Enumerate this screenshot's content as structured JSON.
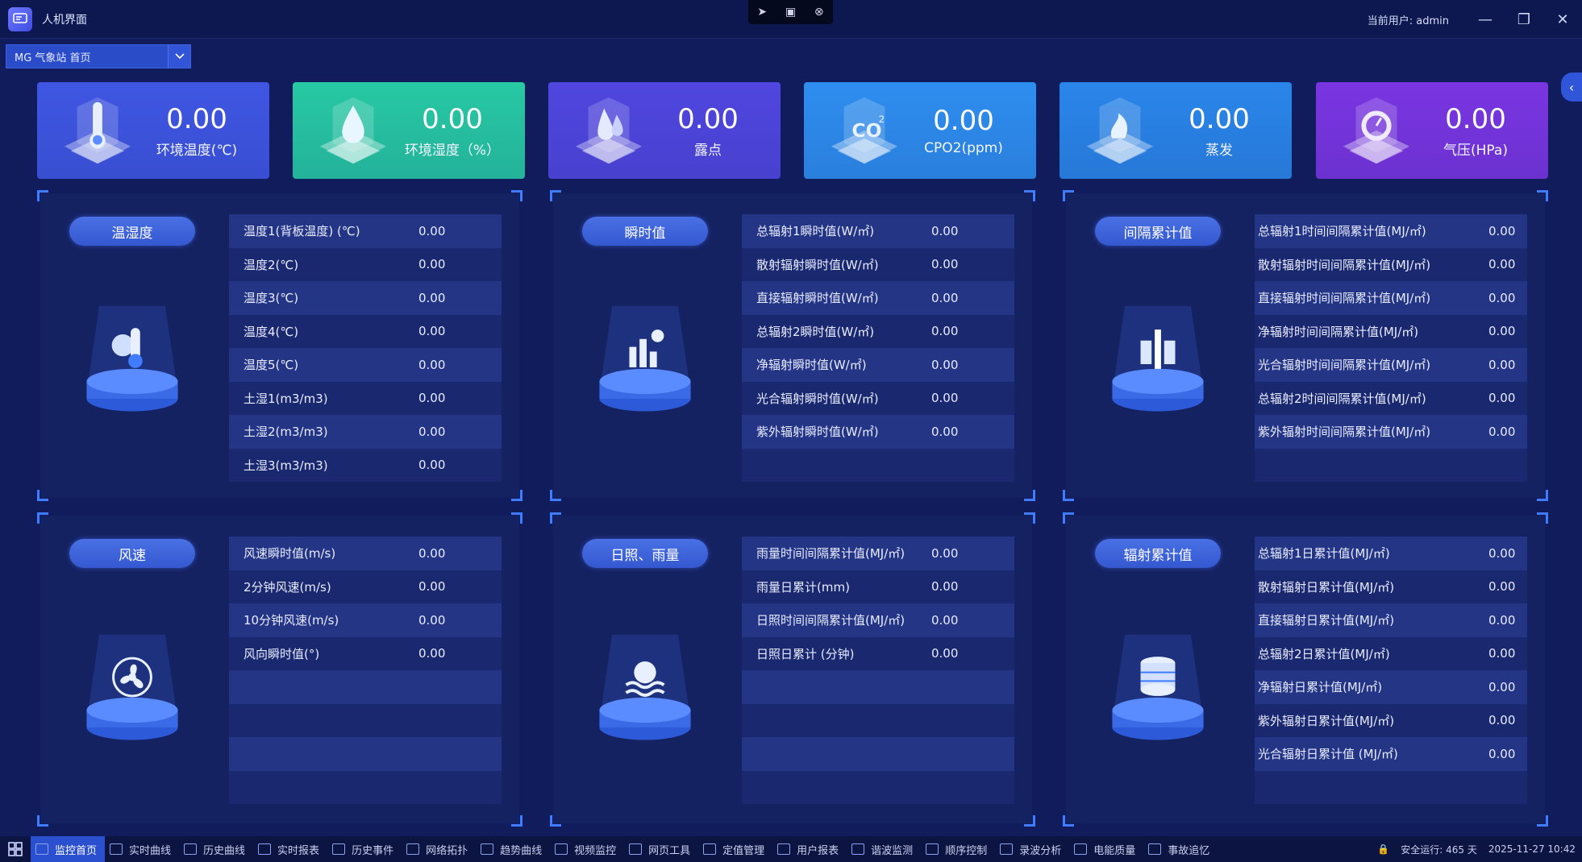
{
  "window": {
    "title": "人机界面",
    "user": "当前用户: admin"
  },
  "page_select": {
    "value": "MG 气象站 首页"
  },
  "cards": [
    {
      "value": "0.00",
      "label": "环境温度(℃)",
      "color": "#3f56e3",
      "icon": "thermometer-icon"
    },
    {
      "value": "0.00",
      "label": "环境湿度（%）",
      "color": "#27c9a4",
      "icon": "humidity-drop-icon"
    },
    {
      "value": "0.00",
      "label": "露点",
      "color": "#5046e0",
      "icon": "dew-point-icon"
    },
    {
      "value": "0.00",
      "label": "CPO2(ppm)",
      "color": "#2e8ef0",
      "icon": "co2-icon"
    },
    {
      "value": "0.00",
      "label": "蒸发",
      "color": "#2a86ea",
      "icon": "evaporation-icon"
    },
    {
      "value": "0.00",
      "label": "气压(HPa)",
      "color": "#7a35e2",
      "icon": "pressure-gauge-icon"
    }
  ],
  "panels": {
    "temp_humidity": {
      "title": "温湿度",
      "rows": [
        {
          "k": "温度1(背板温度) (℃)",
          "v": "0.00"
        },
        {
          "k": "温度2(℃)",
          "v": "0.00"
        },
        {
          "k": "温度3(℃)",
          "v": "0.00"
        },
        {
          "k": "温度4(℃)",
          "v": "0.00"
        },
        {
          "k": "温度5(℃)",
          "v": "0.00"
        },
        {
          "k": "土湿1(m3/m3)",
          "v": "0.00"
        },
        {
          "k": "土湿2(m3/m3)",
          "v": "0.00"
        },
        {
          "k": "土湿3(m3/m3)",
          "v": "0.00"
        }
      ]
    },
    "instant": {
      "title": "瞬时值",
      "rows": [
        {
          "k": "总辐射1瞬时值(W/㎡)",
          "v": "0.00"
        },
        {
          "k": "散射辐射瞬时值(W/㎡)",
          "v": "0.00"
        },
        {
          "k": "直接辐射瞬时值(W/㎡)",
          "v": "0.00"
        },
        {
          "k": "总辐射2瞬时值(W/㎡)",
          "v": "0.00"
        },
        {
          "k": "净辐射瞬时值(W/㎡)",
          "v": "0.00"
        },
        {
          "k": "光合辐射瞬时值(W/㎡)",
          "v": "0.00"
        },
        {
          "k": "紫外辐射瞬时值(W/㎡)",
          "v": "0.00"
        },
        {
          "k": "",
          "v": ""
        }
      ]
    },
    "interval": {
      "title": "间隔累计值",
      "rows": [
        {
          "k": "总辐射1时间间隔累计值(MJ/㎡)",
          "v": "0.00"
        },
        {
          "k": "散射辐射时间间隔累计值(MJ/㎡)",
          "v": "0.00"
        },
        {
          "k": "直接辐射时间间隔累计值(MJ/㎡)",
          "v": "0.00"
        },
        {
          "k": "净辐射时间间隔累计值(MJ/㎡)",
          "v": "0.00"
        },
        {
          "k": "光合辐射时间间隔累计值(MJ/㎡)",
          "v": "0.00"
        },
        {
          "k": "总辐射2时间间隔累计值(MJ/㎡)",
          "v": "0.00"
        },
        {
          "k": "紫外辐射时间间隔累计值(MJ/㎡)",
          "v": "0.00"
        },
        {
          "k": "",
          "v": ""
        }
      ]
    },
    "wind": {
      "title": "风速",
      "rows": [
        {
          "k": "风速瞬时值(m/s)",
          "v": "0.00"
        },
        {
          "k": "2分钟风速(m/s)",
          "v": "0.00"
        },
        {
          "k": "10分钟风速(m/s)",
          "v": "0.00"
        },
        {
          "k": "风向瞬时值(°)",
          "v": "0.00"
        },
        {
          "k": "",
          "v": ""
        },
        {
          "k": "",
          "v": ""
        },
        {
          "k": "",
          "v": ""
        },
        {
          "k": "",
          "v": ""
        }
      ]
    },
    "sun_rain": {
      "title": "日照、雨量",
      "rows": [
        {
          "k": "雨量时间间隔累计值(MJ/㎡)",
          "v": "0.00"
        },
        {
          "k": "雨量日累计(mm)",
          "v": "0.00"
        },
        {
          "k": "日照时间间隔累计值(MJ/㎡)",
          "v": "0.00"
        },
        {
          "k": "日照日累计 (分钟)",
          "v": "0.00"
        },
        {
          "k": "",
          "v": ""
        },
        {
          "k": "",
          "v": ""
        },
        {
          "k": "",
          "v": ""
        },
        {
          "k": "",
          "v": ""
        }
      ]
    },
    "radiation_total": {
      "title": "辐射累计值",
      "rows": [
        {
          "k": "总辐射1日累计值(MJ/㎡)",
          "v": "0.00"
        },
        {
          "k": "散射辐射日累计值(MJ/㎡)",
          "v": "0.00"
        },
        {
          "k": "直接辐射日累计值(MJ/㎡)",
          "v": "0.00"
        },
        {
          "k": "总辐射2日累计值(MJ/㎡)",
          "v": "0.00"
        },
        {
          "k": "净辐射日累计值(MJ/㎡)",
          "v": "0.00"
        },
        {
          "k": "紫外辐射日累计值(MJ/㎡)",
          "v": "0.00"
        },
        {
          "k": "光合辐射日累计值 (MJ/㎡)",
          "v": "0.00"
        },
        {
          "k": "",
          "v": ""
        }
      ]
    }
  },
  "taskbar": {
    "items": [
      "监控首页",
      "实时曲线",
      "历史曲线",
      "实时报表",
      "历史事件",
      "网络拓扑",
      "趋势曲线",
      "视频监控",
      "网页工具",
      "定值管理",
      "用户报表",
      "谐波监测",
      "顺序控制",
      "录波分析",
      "电能质量",
      "事故追忆"
    ],
    "status": "安全运行: 465 天",
    "datetime": "2025-11-27 10:42"
  }
}
